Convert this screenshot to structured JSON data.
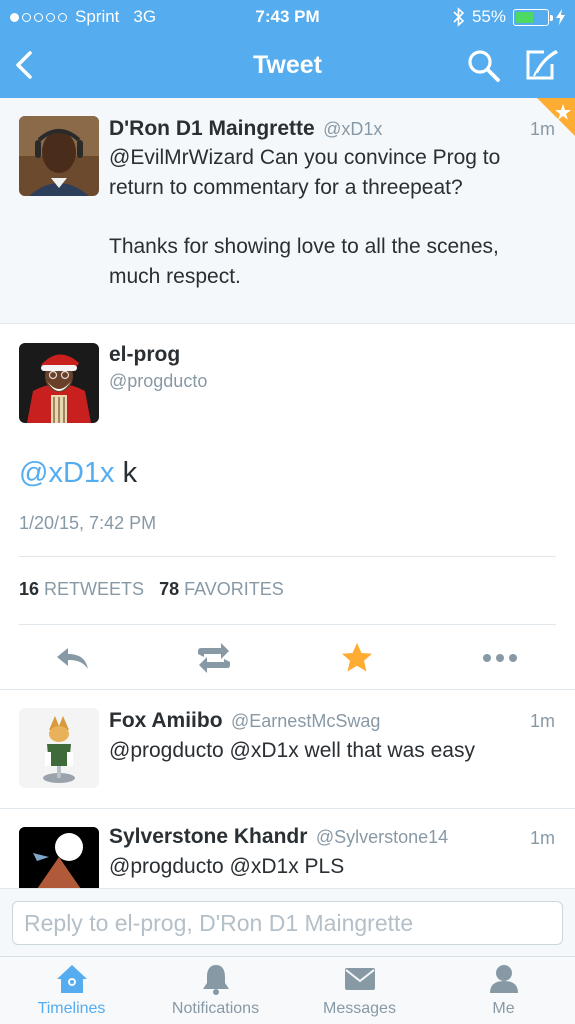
{
  "status_bar": {
    "carrier": "Sprint",
    "network": "3G",
    "time": "7:43 PM",
    "battery": "55%",
    "battery_level": 0.55,
    "signal_bars": 1
  },
  "nav": {
    "title": "Tweet"
  },
  "parent_tweet": {
    "name": "D'Ron D1 Maingrette",
    "handle": "@xD1x",
    "ago": "1m",
    "text_line1": "@EvilMrWizard Can you convince Prog to",
    "text_line2": "return to commentary for a threepeat?",
    "text_line3": "Thanks for showing love to all the scenes,",
    "text_line4": "much respect."
  },
  "main_tweet": {
    "name": "el-prog",
    "handle": "@progducto",
    "mention": "@xD1x",
    "text": " k",
    "date": "1/20/15, 7:42 PM",
    "retweets_count": "16",
    "retweets_label": "RETWEETS",
    "favorites_count": "78",
    "favorites_label": "FAVORITES"
  },
  "replies": [
    {
      "name": "Fox Amiibo",
      "handle": "@EarnestMcSwag",
      "ago": "1m",
      "text": "@progducto @xD1x well that was easy"
    },
    {
      "name": "Sylverstone Khandr",
      "handle": "@Sylverstone14",
      "ago": "1m",
      "text": "@progducto @xD1x PLS"
    }
  ],
  "reply_box": {
    "placeholder": "Reply to el-prog, D'Ron D1 Maingrette"
  },
  "tabs": [
    {
      "label": "Timelines",
      "icon": "home-icon"
    },
    {
      "label": "Notifications",
      "icon": "bell-icon"
    },
    {
      "label": "Messages",
      "icon": "envelope-icon"
    },
    {
      "label": "Me",
      "icon": "person-icon"
    }
  ],
  "colors": {
    "brand_blue": "#55acee",
    "favorite_orange": "#ffac33",
    "battery_green": "#4cd964"
  }
}
